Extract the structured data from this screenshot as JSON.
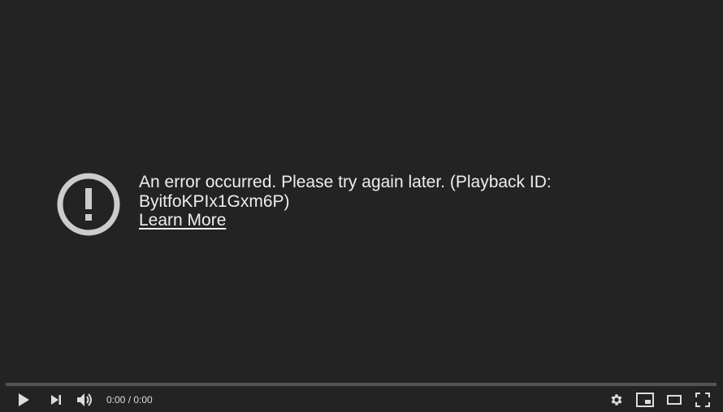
{
  "error": {
    "message": "An error occurred. Please try again later. (Playback ID: ByitfoKPIx1Gxm6P)",
    "learn_more": "Learn More",
    "icon": "alert-circle-icon"
  },
  "player": {
    "progress": 0,
    "time": "0:00 / 0:00",
    "controls": {
      "left": [
        "play-icon",
        "next-icon",
        "volume-icon"
      ],
      "right": [
        "settings-icon",
        "miniplayer-icon",
        "theater-mode-icon",
        "fullscreen-icon"
      ]
    },
    "colors": {
      "background": "#232323",
      "text": "#eeeeee",
      "icon": "#cccccc"
    }
  }
}
